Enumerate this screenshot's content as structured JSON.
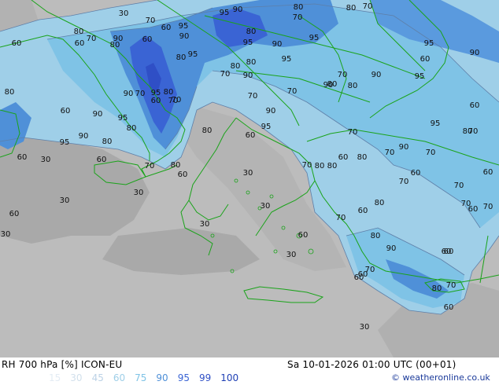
{
  "title": "RH 700 hPa [%] ICON-EU",
  "datetime": "Sa 10-01-2026 01:00 UTC (00+01)",
  "credit": "© weatheronline.co.uk",
  "legend": [
    {
      "value": "15",
      "color": "#e4ecf4"
    },
    {
      "value": "30",
      "color": "#d2e0ec"
    },
    {
      "value": "45",
      "color": "#bcd2e6"
    },
    {
      "value": "60",
      "color": "#9fcfe8"
    },
    {
      "value": "75",
      "color": "#7fc3e6"
    },
    {
      "value": "90",
      "color": "#4f90d8"
    },
    {
      "value": "95",
      "color": "#3a64d4"
    },
    {
      "value": "99",
      "color": "#2f4fc6"
    },
    {
      "value": "100",
      "color": "#1e3fb4"
    }
  ],
  "colors": {
    "background_dry": "#bcbcbc",
    "background_lowrh": "#a9a9a9",
    "coastline": "#1aa31a",
    "contour": "#5e7fa8"
  },
  "contour_labels": [
    {
      "text": "30"
    },
    {
      "text": "70"
    },
    {
      "text": "95"
    },
    {
      "text": "90"
    },
    {
      "text": "80"
    },
    {
      "text": "70"
    },
    {
      "text": "80"
    },
    {
      "text": "70"
    },
    {
      "text": "80"
    },
    {
      "text": "60"
    },
    {
      "text": "70"
    },
    {
      "text": "90"
    },
    {
      "text": "80"
    },
    {
      "text": "60"
    },
    {
      "text": "60"
    },
    {
      "text": "95"
    },
    {
      "text": "90"
    },
    {
      "text": "80"
    },
    {
      "text": "95"
    },
    {
      "text": "95"
    },
    {
      "text": "80"
    },
    {
      "text": "90"
    },
    {
      "text": "95"
    },
    {
      "text": "80"
    },
    {
      "text": "60"
    },
    {
      "text": "95"
    },
    {
      "text": "90"
    },
    {
      "text": "60"
    },
    {
      "text": "80"
    },
    {
      "text": "95"
    },
    {
      "text": "70"
    },
    {
      "text": "90"
    },
    {
      "text": "80"
    },
    {
      "text": "90"
    },
    {
      "text": "70"
    },
    {
      "text": "60"
    },
    {
      "text": "70"
    },
    {
      "text": "80"
    },
    {
      "text": "95"
    },
    {
      "text": "90"
    },
    {
      "text": "80"
    },
    {
      "text": "60"
    },
    {
      "text": "90"
    },
    {
      "text": "95"
    },
    {
      "text": "80"
    },
    {
      "text": "95"
    },
    {
      "text": "70"
    },
    {
      "text": "80"
    },
    {
      "text": "70"
    },
    {
      "text": "70"
    },
    {
      "text": "60"
    },
    {
      "text": "90"
    },
    {
      "text": "95"
    },
    {
      "text": "90"
    },
    {
      "text": "80"
    },
    {
      "text": "70"
    },
    {
      "text": "90"
    },
    {
      "text": "80"
    },
    {
      "text": "95"
    },
    {
      "text": "60"
    },
    {
      "text": "95"
    },
    {
      "text": "80"
    },
    {
      "text": "70"
    },
    {
      "text": "90"
    },
    {
      "text": "60"
    },
    {
      "text": "30"
    },
    {
      "text": "70"
    },
    {
      "text": "60"
    },
    {
      "text": "70"
    },
    {
      "text": "80"
    },
    {
      "text": "60"
    },
    {
      "text": "60"
    },
    {
      "text": "30"
    },
    {
      "text": "80"
    },
    {
      "text": "70"
    },
    {
      "text": "80"
    },
    {
      "text": "80"
    },
    {
      "text": "70"
    },
    {
      "text": "70"
    },
    {
      "text": "30"
    },
    {
      "text": "60"
    },
    {
      "text": "70"
    },
    {
      "text": "30"
    },
    {
      "text": "60"
    },
    {
      "text": "30"
    },
    {
      "text": "60"
    },
    {
      "text": "80"
    },
    {
      "text": "60"
    },
    {
      "text": "30"
    },
    {
      "text": "60"
    },
    {
      "text": "70"
    },
    {
      "text": "60"
    },
    {
      "text": "90"
    },
    {
      "text": "70"
    },
    {
      "text": "60"
    },
    {
      "text": "30"
    },
    {
      "text": "70"
    },
    {
      "text": "80"
    },
    {
      "text": "70"
    },
    {
      "text": "80"
    },
    {
      "text": "60"
    },
    {
      "text": "70"
    },
    {
      "text": "60"
    },
    {
      "text": "70"
    },
    {
      "text": "60"
    },
    {
      "text": "30"
    },
    {
      "text": "30"
    },
    {
      "text": "60"
    }
  ]
}
